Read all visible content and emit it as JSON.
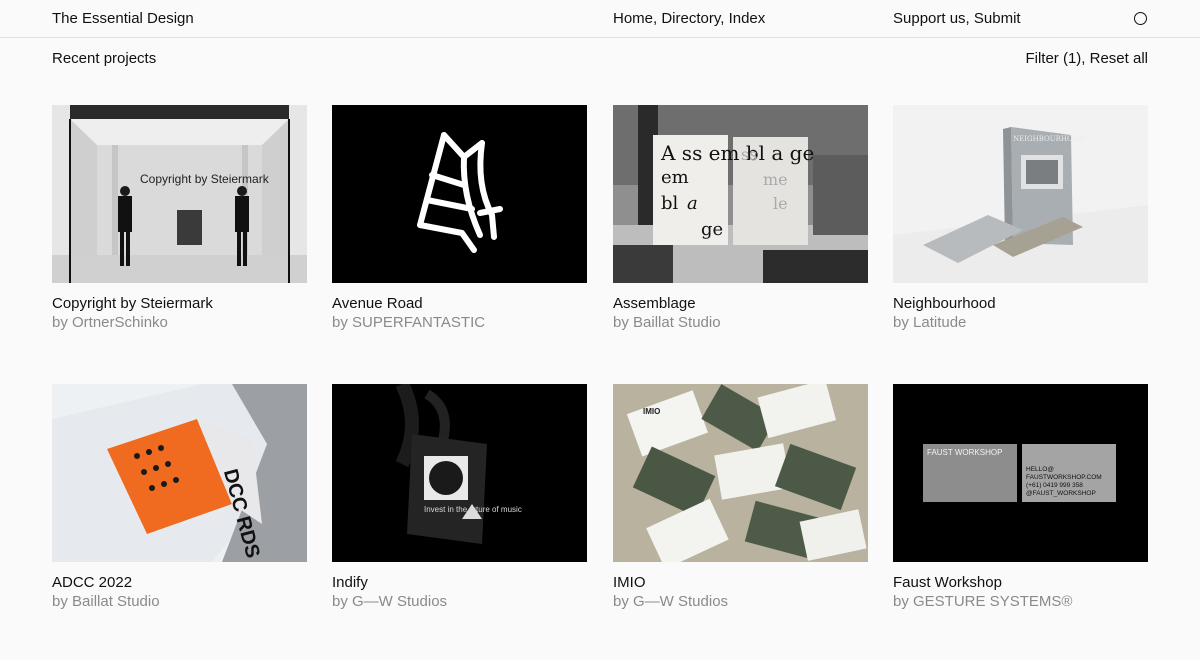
{
  "header": {
    "brand": "The Essential Design",
    "nav": "Home, Directory, Index",
    "support": "Support us, Submit",
    "search_icon": "search-icon"
  },
  "subheader": {
    "title": "Recent projects",
    "filters": "Filter (1), Reset all"
  },
  "projects": [
    {
      "name": "Copyright by Steiermark",
      "by": "by OrtnerSchinko",
      "image_text": "Copyright by Steiermark"
    },
    {
      "name": "Avenue Road",
      "by": "by SUPERFANTASTIC"
    },
    {
      "name": "Assemblage",
      "by": "by Baillat Studio",
      "image_text": "A ss em bl a ge"
    },
    {
      "name": "Neighbourhood",
      "by": "by Latitude",
      "image_text": "NEIGHBOURHOOD"
    },
    {
      "name": "ADCC 2022",
      "by": "by Baillat Studio",
      "image_text": "DCC RDS DN"
    },
    {
      "name": "Indify",
      "by": "by G—W Studios",
      "image_text": "Invest in the future of music"
    },
    {
      "name": "IMIO",
      "by": "by G—W Studios",
      "image_text": "IMIO"
    },
    {
      "name": "Faust Workshop",
      "by": "by GESTURE SYSTEMS®",
      "image_text": "FAUST WORKSHOP",
      "image_text_2": "HELLO@ FAUSTWORKSHOP.COM (+61) 0419 999 358 @FAUST_WORKSHOP"
    }
  ]
}
